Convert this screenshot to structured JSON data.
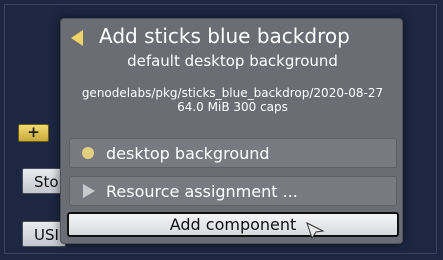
{
  "background_buttons": {
    "plus_label": "+",
    "sto_label": "Sto",
    "usb_label": "USI"
  },
  "dialog": {
    "title": "Add sticks blue backdrop",
    "subtitle": "default desktop background",
    "pkg_path": "genodelabs/pkg/sticks_blue_backdrop/2020-08-27",
    "pkg_info": "64.0 MiB 300 caps",
    "options": [
      {
        "label": "desktop background",
        "icon": "radio-dot-icon"
      },
      {
        "label": "Resource assignment ...",
        "icon": "expand-triangle-icon"
      }
    ],
    "add_label": "Add component"
  },
  "colors": {
    "desktop_bg": "#1d2742",
    "dialog_bg": "#6a6d74",
    "accent_yellow": "#f0d468"
  }
}
